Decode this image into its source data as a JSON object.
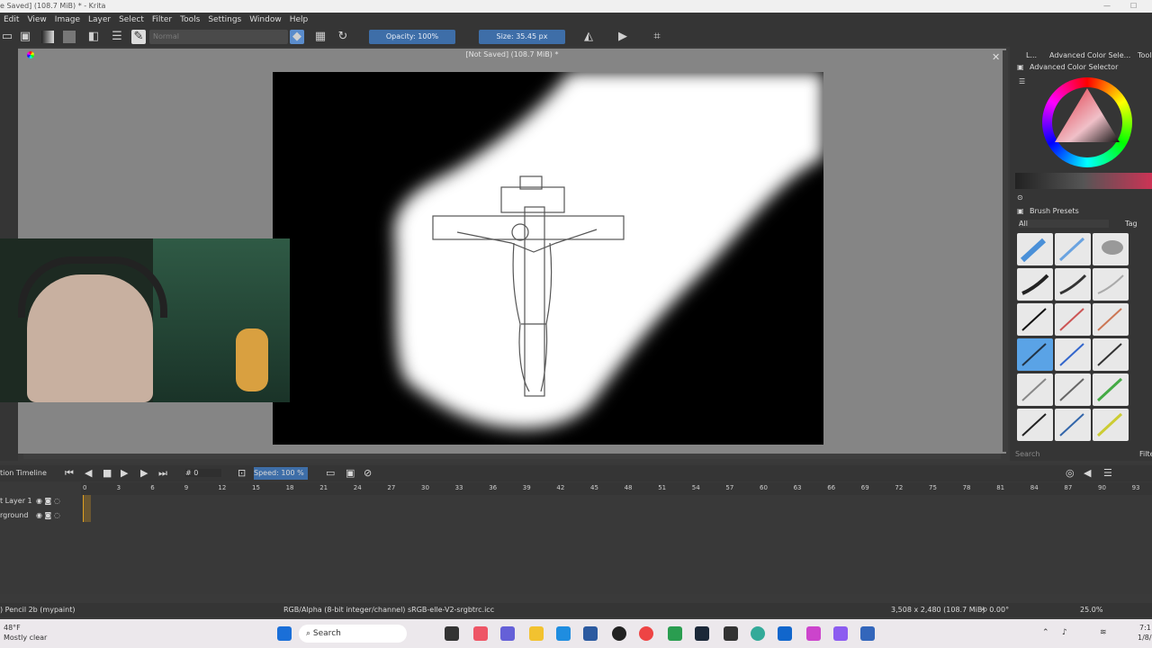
{
  "window": {
    "title": "e Saved]  (108.7 MiB) * - Krita"
  },
  "menu": [
    "Edit",
    "View",
    "Image",
    "Layer",
    "Select",
    "Filter",
    "Tools",
    "Settings",
    "Window",
    "Help"
  ],
  "toolbar": {
    "blend_mode": "Normal",
    "opacity": "Opacity: 100%",
    "size": "Size: 35.45 px"
  },
  "document": {
    "title": "[Not Saved]  (108.7 MiB) *"
  },
  "dockers": {
    "tab_small": "L...",
    "tab_color": "Advanced Color Sele...",
    "tab_tool": "Tool",
    "color_selector_title": "Advanced Color Selector",
    "brush_presets_title": "Brush Presets",
    "filter_all": "All",
    "tag_label": "Tag",
    "search_placeholder": "Search",
    "filter_label": "Filte"
  },
  "timeline": {
    "title": "tion Timeline",
    "frame": "0",
    "speed_label": "Speed:",
    "speed": "100 %",
    "ruler": [
      "0",
      "3",
      "6",
      "9",
      "12",
      "15",
      "18",
      "21",
      "24",
      "27",
      "30",
      "33",
      "36",
      "39",
      "42",
      "45",
      "48",
      "51",
      "54",
      "57",
      "60",
      "63",
      "66",
      "69",
      "72",
      "75",
      "78",
      "81",
      "84",
      "87",
      "90",
      "93"
    ],
    "layers": [
      "t Layer 1",
      "rground"
    ]
  },
  "status": {
    "brush": ") Pencil 2b (mypaint)",
    "color_space": "RGB/Alpha (8-bit integer/channel)  sRGB-elle-V2-srgbtrc.icc",
    "image_size": "3,508 x 2,480 (108.7 MiB)",
    "rotation": "0.00°",
    "zoom": "25.0%"
  },
  "taskbar": {
    "weather_temp": "48°F",
    "weather_desc": "Mostly clear",
    "search": "Search",
    "time": "7:1",
    "date": "1/8/"
  },
  "colors": {
    "accent": "#3e6ea8",
    "panel": "#353535",
    "canvas_bg": "#858585"
  }
}
